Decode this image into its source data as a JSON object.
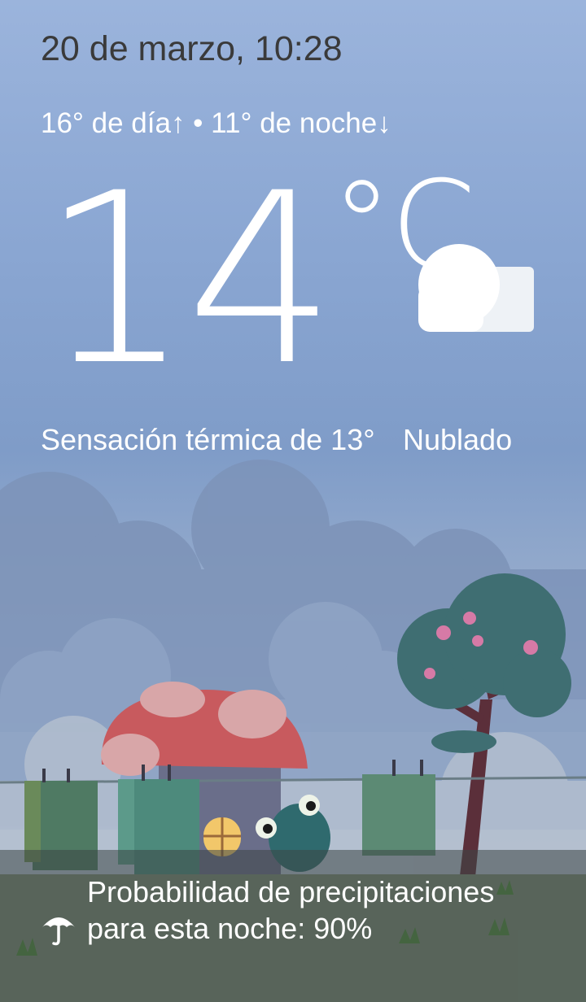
{
  "header": {
    "datetime": "20 de marzo, 10:28",
    "high_low": "16° de día↑ • 11° de noche↓"
  },
  "current": {
    "temperature": "14",
    "unit": "°C",
    "feels_like": "Sensación térmica de 13°",
    "condition": "Nublado",
    "condition_icon": "cloud-icon"
  },
  "precipitation": {
    "icon": "umbrella-icon",
    "text": "Probabilidad de precipitaciones para esta noche: 90%"
  },
  "colors": {
    "text_dark": "#3a3a3a",
    "mushroom_cap": "#c85a5e",
    "tree_foliage": "#3f6e72"
  }
}
